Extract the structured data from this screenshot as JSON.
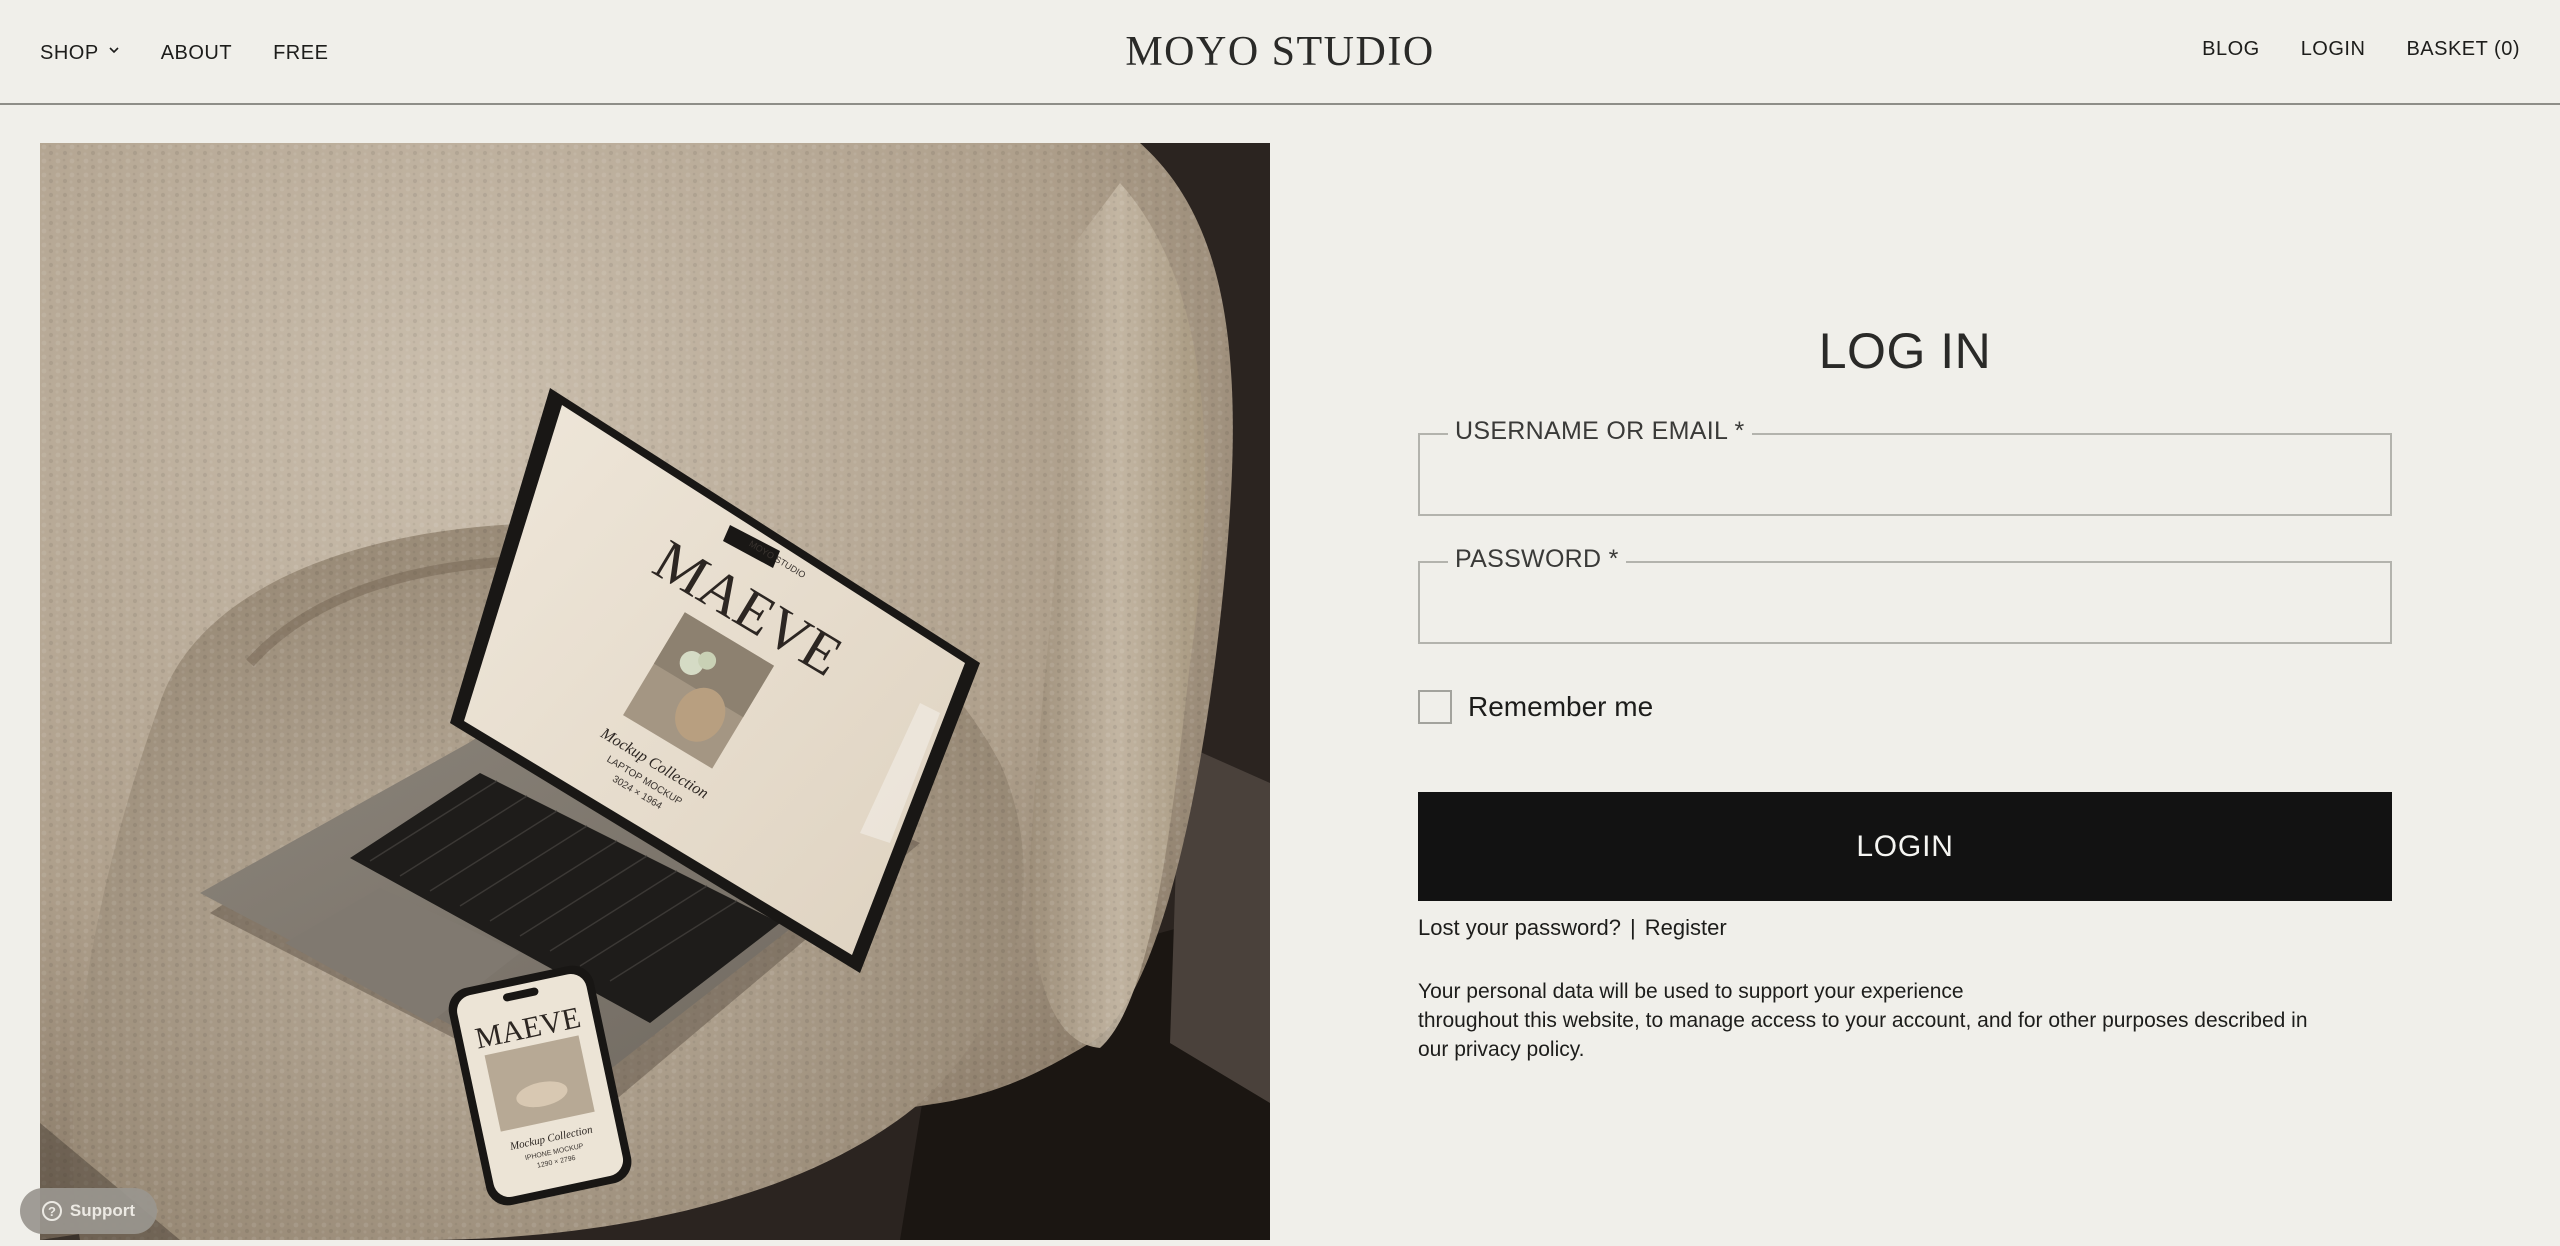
{
  "header": {
    "logo": "MOYO STUDIO",
    "nav_left": [
      {
        "label": "SHOP"
      },
      {
        "label": "ABOUT"
      },
      {
        "label": "FREE"
      }
    ],
    "nav_right": [
      {
        "label": "BLOG"
      },
      {
        "label": "LOGIN"
      },
      {
        "label": "BASKET (0)"
      }
    ]
  },
  "hero": {
    "laptop_screen": {
      "brand": "MOYO STUDIO",
      "title": "MAEVE",
      "subtitle": "Mockup Collection",
      "line1": "LAPTOP MOCKUP",
      "line2": "3024 × 1964"
    },
    "phone_screen": {
      "title": "MAEVE",
      "subtitle": "Mockup Collection",
      "line1": "IPHONE MOCKUP",
      "line2": "1290 × 2796"
    }
  },
  "login": {
    "title": "LOG IN",
    "username_label": "USERNAME OR EMAIL *",
    "username_value": "",
    "password_label": "PASSWORD *",
    "password_value": "",
    "remember_label": "Remember me",
    "remember_checked": false,
    "submit_label": "LOGIN",
    "lost_password": "Lost your password?",
    "separator": "|",
    "register": "Register",
    "privacy_line1": "Your personal data will be used to support your experience",
    "privacy_line2": "throughout this website, to manage access to your account, and for other purposes described in",
    "privacy_line3_prefix": "our ",
    "privacy_link": "privacy policy",
    "privacy_suffix": "."
  },
  "support": {
    "icon": "question-circle-icon",
    "label": "Support"
  },
  "colors": {
    "background": "#f0efea",
    "button": "#121212",
    "text": "#1d1d1b"
  }
}
